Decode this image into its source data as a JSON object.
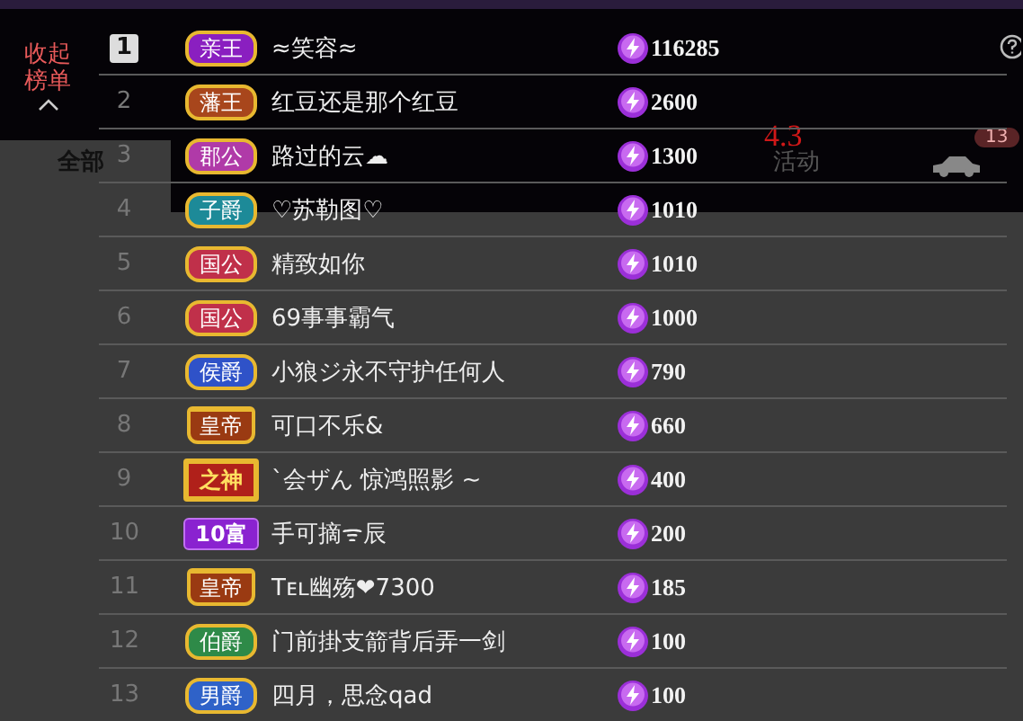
{
  "collapse_button": {
    "label": "收起榜单"
  },
  "background_tabs": [
    {
      "label": "全部",
      "selected": true
    },
    {
      "label": "活动",
      "selected": false
    }
  ],
  "version_label": "4.3",
  "car_badge": "13",
  "ranking": [
    {
      "rank": "1",
      "highlighted": true,
      "title": {
        "label": "亲王",
        "kind": "noble",
        "color": "#8a1fc0"
      },
      "name": "≈笑容≈",
      "amount": "116285"
    },
    {
      "rank": "2",
      "highlighted": false,
      "title": {
        "label": "藩王",
        "kind": "noble",
        "color": "#a8461c"
      },
      "name": "红豆还是那个红豆",
      "amount": "2600"
    },
    {
      "rank": "3",
      "highlighted": false,
      "title": {
        "label": "郡公",
        "kind": "noble",
        "color": "#b03aa8"
      },
      "name": "路过的云☁",
      "amount": "1300"
    },
    {
      "rank": "4",
      "highlighted": false,
      "title": {
        "label": "子爵",
        "kind": "noble",
        "color": "#1d8a98"
      },
      "name": "♡苏勒图♡",
      "amount": "1010"
    },
    {
      "rank": "5",
      "highlighted": false,
      "title": {
        "label": "国公",
        "kind": "noble",
        "color": "#c0304a"
      },
      "name": "精致如你",
      "amount": "1010"
    },
    {
      "rank": "6",
      "highlighted": false,
      "title": {
        "label": "国公",
        "kind": "noble",
        "color": "#c0304a"
      },
      "name": "69事事霸气",
      "amount": "1000"
    },
    {
      "rank": "7",
      "highlighted": false,
      "title": {
        "label": "侯爵",
        "kind": "noble",
        "color": "#2f52c8"
      },
      "name": "小狼ジ永不守护任何人",
      "amount": "790"
    },
    {
      "rank": "8",
      "highlighted": false,
      "title": {
        "label": "皇帝",
        "kind": "emperor",
        "color": "#9a3a12"
      },
      "name": "可口不乐&",
      "amount": "660"
    },
    {
      "rank": "9",
      "highlighted": false,
      "title": {
        "label": "之神",
        "kind": "god",
        "color": "#b0201a"
      },
      "name": "`会ザん 惊鸿照影 ~",
      "amount": "400"
    },
    {
      "rank": "10",
      "highlighted": false,
      "title": {
        "label": "10富",
        "kind": "rich",
        "color": "#8a22d0"
      },
      "name": "手可摘ᯤ辰",
      "amount": "200"
    },
    {
      "rank": "11",
      "highlighted": false,
      "title": {
        "label": "皇帝",
        "kind": "emperor",
        "color": "#9a3a12"
      },
      "name": "Tᴇʟ幽殇❤7300",
      "amount": "185"
    },
    {
      "rank": "12",
      "highlighted": false,
      "title": {
        "label": "伯爵",
        "kind": "noble",
        "color": "#2e8a48"
      },
      "name": "门前掛支箭背后弄一剑",
      "amount": "100"
    },
    {
      "rank": "13",
      "highlighted": false,
      "title": {
        "label": "男爵",
        "kind": "noble",
        "color": "#2f62c8"
      },
      "name": "四月，思念qad",
      "amount": "100"
    }
  ]
}
